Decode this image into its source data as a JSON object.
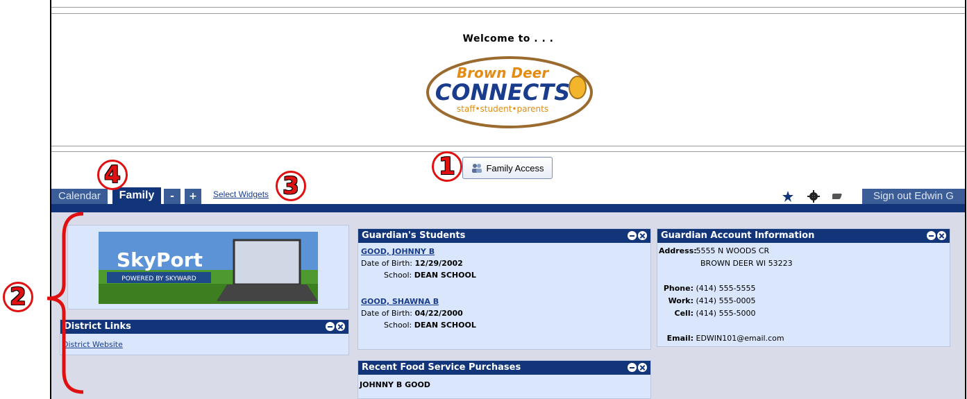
{
  "header": {
    "welcome": "Welcome to . . .",
    "logo_line1": "Brown Deer",
    "logo_line2": "CONNECTS",
    "logo_line3": "staff•student•parents"
  },
  "family_access_button": "Family Access",
  "tabs": {
    "calendar": "Calendar",
    "family": "Family",
    "minus": "-",
    "plus": "+",
    "select_widgets": "Select Widgets",
    "signout": "Sign out Edwin G"
  },
  "skyport": {
    "title": "SkyPort",
    "subtitle": "POWERED BY SKYWARD"
  },
  "district_links": {
    "title": "District Links",
    "link": "District Website"
  },
  "guardians_students": {
    "title": "Guardian's Students",
    "dob_label": "Date of Birth:",
    "school_label": "School:",
    "students": [
      {
        "name": "GOOD, JOHNNY B",
        "dob": "12/29/2002",
        "school": "DEAN SCHOOL"
      },
      {
        "name": "GOOD, SHAWNA B",
        "dob": "04/22/2000",
        "school": "DEAN SCHOOL"
      }
    ]
  },
  "food_service": {
    "title": "Recent Food Service Purchases",
    "student": "JOHNNY B GOOD"
  },
  "guardian_account": {
    "title": "Guardian Account Information",
    "address_label": "Address:",
    "address1": "5555 N WOODS CR",
    "address2": "BROWN DEER WI 53223",
    "phone_label": "Phone:",
    "phone": "(414) 555-5555",
    "work_label": "Work:",
    "work": "(414) 555-0005",
    "cell_label": "Cell:",
    "cell": "(414) 555-5000",
    "email_label": "Email:",
    "email": "EDWIN101@email.com"
  },
  "markers": [
    "1",
    "2",
    "3",
    "4"
  ],
  "colors": {
    "nav_dark": "#12357a",
    "tab": "#3a5c97",
    "panel_bg": "#d9e6fb",
    "content_bg": "#dadbe9",
    "marker": "#e01010"
  }
}
